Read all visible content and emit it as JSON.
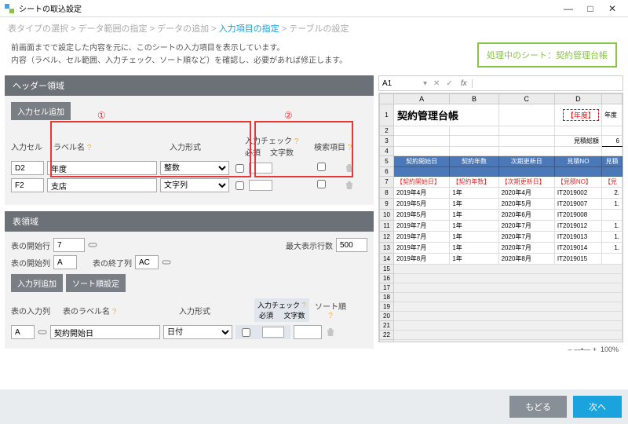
{
  "window": {
    "title": "シートの取込設定"
  },
  "breadcrumb": {
    "step1": "表タイプの選択",
    "step2": "データ範囲の指定",
    "step3": "データの追加",
    "step4": "入力項目の指定",
    "step5": "テーブルの設定",
    "sep": " > "
  },
  "intro": {
    "line1": "前画面までで設定した内容を元に、このシートの入力項目を表示しています。",
    "line2": "内容（ラベル、セル範囲、入力チェック、ソート順など）を確認し、必要があれば修正します。"
  },
  "sheet_badge": "処理中のシート：契約管理台帳",
  "header_area": {
    "title": "ヘッダー領域",
    "add_btn": "入力セル追加",
    "anno1": "①",
    "anno2": "②",
    "cols": {
      "cell": "入力セル",
      "label": "ラベル名",
      "format": "入力形式",
      "check": "入力チェック",
      "required": "必須",
      "chars": "文字数",
      "search": "検索項目"
    },
    "rows": [
      {
        "cell": "D2",
        "label": "年度",
        "format": "整数"
      },
      {
        "cell": "F2",
        "label": "支店",
        "format": "文字列"
      }
    ]
  },
  "table_area": {
    "title": "表領域",
    "start_row": "表の開始行",
    "start_row_val": "7",
    "max_rows": "最大表示行数",
    "max_rows_val": "500",
    "start_col": "表の開始列",
    "start_col_val": "A",
    "end_col": "表の終了列",
    "end_col_val": "AC",
    "add_col_btn": "入力列追加",
    "sort_btn": "ソート順設定",
    "cols": {
      "inputcol": "表の入力列",
      "label": "表のラベル名",
      "format": "入力形式",
      "check": "入力チェック",
      "required": "必須",
      "chars": "文字数",
      "sort": "ソート順"
    },
    "row": {
      "col": "A",
      "label": "契約開始日",
      "format": "日付"
    }
  },
  "preview": {
    "cellref": "A1",
    "cols": [
      "A",
      "B",
      "C",
      "D"
    ],
    "title": "契約管理台帳",
    "year_label": "【年度】",
    "year_suffix": "年度",
    "sum_label": "見積総額",
    "sum_val": "6",
    "headers": [
      "契約開始日",
      "契約年数",
      "次期更新日",
      "見積NO",
      "見積"
    ],
    "red_headers": [
      "【契約開始日】",
      "【契約年数】",
      "【次期更新日】",
      "【見積NO】",
      "【見"
    ],
    "rows": [
      {
        "n": "8",
        "a": "2019年4月",
        "b": "1年",
        "c": "2020年4月",
        "d": "IT2019002",
        "e": "2."
      },
      {
        "n": "9",
        "a": "2019年5月",
        "b": "1年",
        "c": "2020年5月",
        "d": "IT2019007",
        "e": "1."
      },
      {
        "n": "10",
        "a": "2019年5月",
        "b": "1年",
        "c": "2020年6月",
        "d": "IT2019008",
        "e": ""
      },
      {
        "n": "11",
        "a": "2019年7月",
        "b": "1年",
        "c": "2020年7月",
        "d": "IT2019012",
        "e": "1."
      },
      {
        "n": "12",
        "a": "2019年7月",
        "b": "1年",
        "c": "2020年7月",
        "d": "IT2019013",
        "e": "1."
      },
      {
        "n": "13",
        "a": "2019年7月",
        "b": "1年",
        "c": "2020年7月",
        "d": "IT2019014",
        "e": "1."
      },
      {
        "n": "14",
        "a": "2019年8月",
        "b": "1年",
        "c": "2020年8月",
        "d": "IT2019015",
        "e": ""
      }
    ],
    "zoom": "100%"
  },
  "footer": {
    "back": "もどる",
    "next": "次へ"
  }
}
